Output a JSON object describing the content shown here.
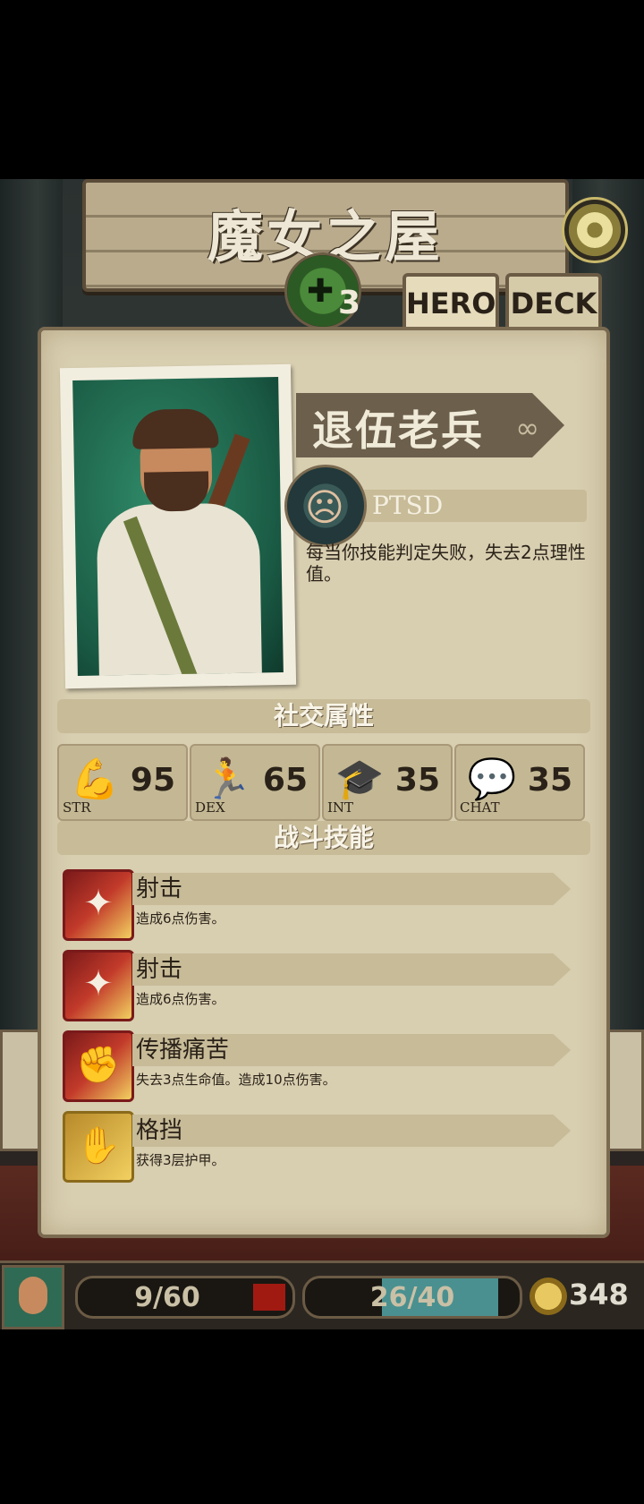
{
  "location_title": "魔女之屋",
  "heal_count": "3",
  "tabs": {
    "hero": "HERO",
    "deck": "DECK"
  },
  "hero": {
    "class_name": "退伍老兵",
    "trait": {
      "name": "PTSD",
      "description": "每当你技能判定失败，失去2点理性值。"
    }
  },
  "social_section_title": "社交属性",
  "stats": [
    {
      "label": "STR",
      "value": "95",
      "icon": "muscle-icon"
    },
    {
      "label": "DEX",
      "value": "65",
      "icon": "runner-icon"
    },
    {
      "label": "INT",
      "value": "35",
      "icon": "scholar-icon"
    },
    {
      "label": "CHAT",
      "value": "35",
      "icon": "speech-icon"
    }
  ],
  "combat_section_title": "战斗技能",
  "skills": [
    {
      "name": "射击",
      "desc": "造成6点伤害。",
      "icon": "gun-shot-icon"
    },
    {
      "name": "射击",
      "desc": "造成6点伤害。",
      "icon": "gun-shot-icon"
    },
    {
      "name": "传播痛苦",
      "desc": "失去3点生命值。造成10点伤害。",
      "icon": "bleeding-hand-icon"
    },
    {
      "name": "格挡",
      "desc": "获得3层护甲。",
      "icon": "block-arm-icon"
    }
  ],
  "hud": {
    "hp": "9/60",
    "hp_current": 9,
    "hp_max": 60,
    "sanity": "26/40",
    "sanity_current": 26,
    "sanity_max": 40,
    "coins": "348"
  },
  "colors": {
    "hp": "#a01a12",
    "sanity": "#4a9090",
    "parchment": "#d8ceb0"
  }
}
